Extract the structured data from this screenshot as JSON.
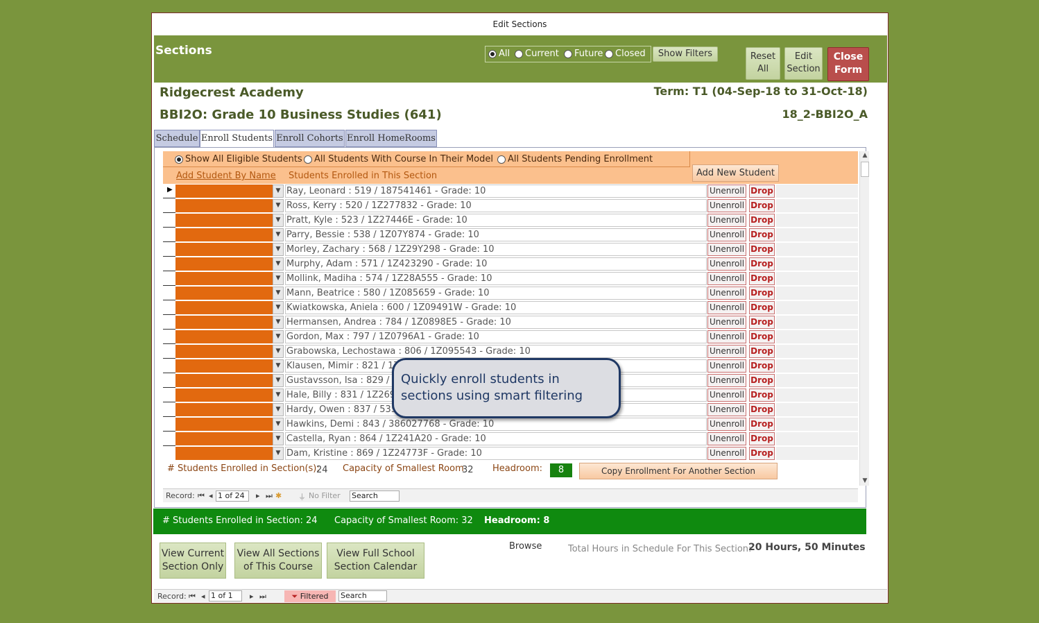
{
  "window": {
    "title": "Edit Sections"
  },
  "header": {
    "title": "Sections",
    "filters": [
      "All",
      "Current",
      "Future",
      "Closed"
    ],
    "selected_filter": "All",
    "show_filters": "Show Filters",
    "reset_all_line1": "Reset",
    "reset_all_line2": "All",
    "edit_section_line1": "Edit",
    "edit_section_line2": "Section",
    "close_form_line1": "Close",
    "close_form_line2": "Form"
  },
  "info": {
    "school": "Ridgecrest Academy",
    "course": "BBI2O: Grade 10 Business Studies (641)",
    "term": "Term: T1 (04-Sep-18 to 31-Oct-18)",
    "section_code": "18_2-BBI2O_A"
  },
  "tabs": [
    "Schedule",
    "Enroll Students",
    "Enroll Cohorts",
    "Enroll HomeRooms"
  ],
  "active_tab": "Enroll Students",
  "enroll": {
    "options": [
      "Show All Eligible Students",
      "All Students With Course In Their Model",
      "All Students Pending Enrollment"
    ],
    "selected_option": "Show All Eligible Students",
    "add_by_name": "Add Student By Name",
    "enrolled_label": "Students Enrolled in This Section",
    "add_new": "Add New Student",
    "unenroll": "Unenroll",
    "drop": "Drop",
    "students": [
      "Ray, Leonard : 519 / 187541461 -  Grade: 10",
      "Ross, Kerry : 520 / 1Z277832 -  Grade: 10",
      "Pratt, Kyle : 523 / 1Z27446E -  Grade: 10",
      "Parry, Bessie : 538 / 1Z07Y874 -  Grade: 10",
      "Morley, Zachary : 568 / 1Z29Y298 -  Grade: 10",
      "Murphy, Adam : 571 / 1Z423290 -  Grade: 10",
      "Mollink, Madiha : 574 / 1Z28A555 -  Grade: 10",
      "Mann, Beatrice : 580 / 1Z085659 -  Grade: 10",
      "Kwiatkowska, Aniela : 600 / 1Z09491W -  Grade: 10",
      "Hermansen, Andrea : 784 / 1Z0898E5 -  Grade: 10",
      "Gordon, Max : 797 / 1Z0796A1 -  Grade: 10",
      "Grabowska, Lechostawa : 806 / 1Z095543 -  Grade: 10",
      "Klausen, Mimir : 821 / 1Z4",
      "Gustavsson, Isa : 829 / 1Z",
      "Hale, Billy : 831 / 1Z26992",
      "Hardy, Owen : 837 / 53568",
      "Hawkins, Demi : 843 / 386027768 -  Grade: 10",
      "Castella, Ryan : 864 / 1Z241A20 -  Grade: 10",
      "Dam, Kristine : 869 / 1Z24773F -  Grade: 10"
    ],
    "count_label": "# Students Enrolled in Section(s):",
    "count_value": "24",
    "capacity_label": "Capacity of Smallest Room",
    "capacity_value": "32",
    "headroom_label": "Headroom:",
    "headroom_value": "8",
    "copy_button": "Copy Enrollment For Another Section"
  },
  "inner_nav": {
    "record_label": "Record:",
    "position": "1 of 24",
    "filter": "No Filter",
    "search": "Search"
  },
  "summary": {
    "enrolled": "# Students Enrolled in Section: 24",
    "capacity": "Capacity of Smallest Room: 32",
    "headroom": "Headroom: 8"
  },
  "footer": {
    "view_current_1": "View Current",
    "view_current_2": "Section Only",
    "view_all_1": "View All Sections",
    "view_all_2": "of This Course",
    "view_calendar_1": "View Full School",
    "view_calendar_2": "Section Calendar",
    "browse": "Browse",
    "total_label": "Total Hours in Schedule For This Section:",
    "total_value": "20 Hours, 50 Minutes"
  },
  "outer_nav": {
    "record_label": "Record:",
    "position": "1 of 1",
    "filtered": "Filtered",
    "search": "Search"
  },
  "callout": {
    "line1": "Quickly enroll students in",
    "line2": "sections using smart filtering"
  },
  "colors": {
    "header_green": "#7a953d",
    "orange": "#e2690f",
    "status_green": "#0f8a0f",
    "close_red": "#b94e4c"
  }
}
